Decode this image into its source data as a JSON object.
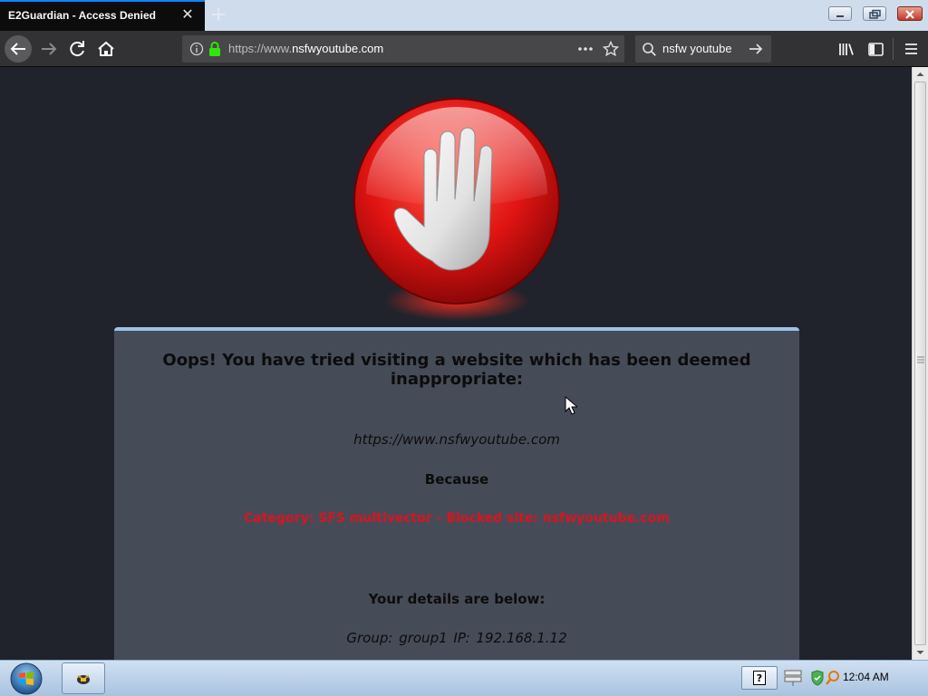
{
  "browser": {
    "tab_title": "E2Guardian - Access Denied",
    "url_prefix": "https://www.",
    "url_domain": "nsfwyoutube.com",
    "search_query": "nsfw youtube"
  },
  "page": {
    "heading": "Oops! You have tried visiting a website which has been deemed inappropriate:",
    "blocked_url": "https://www.nsfwyoutube.com",
    "because_label": "Because",
    "reason": "Category: SFS multivector - Blocked site: nsfwyoutube.com",
    "details_label": "Your details are below:",
    "details": "Group: group1   IP: 192.168.1.12"
  },
  "taskbar": {
    "clock": "12:04 AM"
  },
  "colors": {
    "tab_active_bg": "#0c0c0d",
    "toolbar_bg": "#323234",
    "page_bg": "#20232b",
    "panel_bg": "#464b58",
    "panel_border": "#9fc2e6",
    "reason_text": "#d9141e",
    "lock_green": "#30e60b"
  },
  "icons": [
    "close-icon",
    "plus-icon",
    "back-arrow-icon",
    "forward-arrow-icon",
    "reload-icon",
    "home-icon",
    "info-icon",
    "lock-icon",
    "more-dots-icon",
    "bookmark-star-icon",
    "search-icon",
    "arrow-right-icon",
    "library-icon",
    "sidebar-icon",
    "hamburger-menu-icon",
    "stop-hand-icon",
    "windows-start-icon",
    "help-icon",
    "network-icon",
    "security-icon"
  ]
}
